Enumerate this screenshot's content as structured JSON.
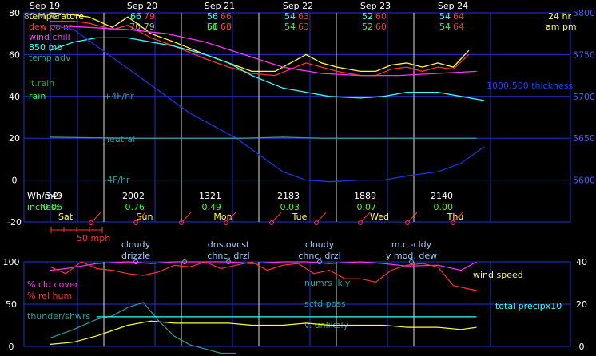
{
  "colors": {
    "temperature": "#ffff33",
    "dew_point": "#ff3333",
    "wind_chill": "#ff33ff",
    "mb850": "#33ffff",
    "temp_adv": "#339999",
    "rain": "#33ff33",
    "grid": "#2233cc",
    "thickness": "#2233dd",
    "day_line": "#ffffff",
    "white": "#ffffff"
  },
  "chart_data": [
    {
      "type": "line",
      "title": "",
      "dates": [
        "Sep 19",
        "Sep 20",
        "Sep 21",
        "Sep 22",
        "Sep 23",
        "Sep 24"
      ],
      "day_names": [
        "Sat",
        "Sun",
        "Mon",
        "Tue",
        "Wed",
        "Thu"
      ],
      "ylim": [
        -20,
        80
      ],
      "yticks": [
        "80",
        "60",
        "40",
        "20",
        "0",
        "-20"
      ],
      "y2lim": [
        5550,
        5800
      ],
      "y2ticks": [
        "5800",
        "5750",
        "5700",
        "5650",
        "5600"
      ],
      "daily_temps": [
        {
          "hi": "56",
          "lo": "66"
        },
        {
          "hi": "56",
          "lo": "66"
        },
        {
          "hi": "56",
          "lo": "66"
        },
        {
          "hi": "54",
          "lo": "63"
        },
        {
          "hi": "52",
          "lo": "60"
        },
        {
          "hi": "54",
          "lo": "64"
        }
      ],
      "daily_temps_header": [
        {
          "a": "66",
          "b": "79"
        }
      ],
      "top_text": {
        "hr": "24 hr",
        "ampm": "am pm",
        "first": "80 M 78",
        "first2": "70 79"
      },
      "labels": {
        "temperature": "temperature",
        "dew_point": "dew point",
        "wind_chill": "wind chill",
        "mb850": "850 mb",
        "temp_adv": "temp adv",
        "lt_rain": "lt.rain",
        "rain": "rain",
        "plus4": "+4F/hr",
        "neutral": "neutral",
        "minus4": "-4F/hr",
        "thickness": "1000:500 thickness",
        "wh": "Wh/m2:",
        "inches": "inches:",
        "scale": "50 mph"
      },
      "wh_values": [
        "349",
        "2002",
        "1321",
        "2183",
        "1889",
        "2140"
      ],
      "inch_values": [
        "0.06",
        "0.76",
        "0.49",
        "0.03",
        "0.07",
        "0.00"
      ],
      "series": [
        {
          "name": "temperature",
          "x": [
            0,
            0.3,
            0.5,
            0.8,
            1,
            1.3,
            1.6,
            2,
            2.3,
            2.6,
            2.9,
            3.1,
            3.3,
            3.5,
            3.7,
            4,
            4.2,
            4.4,
            4.6,
            4.8,
            5,
            5.2,
            5.4
          ],
          "values": [
            80,
            79,
            78,
            73,
            78,
            70,
            66,
            60,
            56,
            52,
            52,
            56,
            60,
            56,
            54,
            52,
            52,
            55,
            56,
            54,
            56,
            54,
            62
          ]
        },
        {
          "name": "dew point",
          "x": [
            0,
            0.3,
            0.5,
            0.8,
            1,
            1.3,
            1.6,
            2,
            2.3,
            2.6,
            2.9,
            3.1,
            3.3,
            3.5,
            3.7,
            4,
            4.2,
            4.4,
            4.6,
            4.8,
            5,
            5.2,
            5.4
          ],
          "values": [
            76,
            76,
            75,
            72,
            74,
            68,
            64,
            58,
            54,
            51,
            50,
            53,
            56,
            54,
            52,
            50,
            50,
            53,
            54,
            52,
            54,
            53,
            60
          ]
        },
        {
          "name": "wind chill",
          "x": [
            0,
            0.5,
            1,
            1.5,
            2,
            2.5,
            3,
            3.5,
            4,
            4.5,
            5,
            5.5
          ],
          "values": [
            74,
            73,
            72,
            70,
            66,
            60,
            54,
            51,
            50,
            50,
            51,
            52
          ]
        },
        {
          "name": "850 mb",
          "x": [
            0,
            0.3,
            0.6,
            1,
            1.3,
            1.6,
            2,
            2.3,
            2.6,
            3,
            3.3,
            3.6,
            4,
            4.3,
            4.6,
            5,
            5.3,
            5.6
          ],
          "values": [
            5755,
            5765,
            5770,
            5770,
            5765,
            5760,
            5750,
            5740,
            5725,
            5710,
            5705,
            5700,
            5698,
            5700,
            5705,
            5705,
            5700,
            5695
          ]
        },
        {
          "name": "1000:500 thickness",
          "x": [
            0,
            0.3,
            0.6,
            0.9,
            1.2,
            1.5,
            1.8,
            2.1,
            2.4,
            2.7,
            3,
            3.3,
            3.6,
            4,
            4.3,
            4.6,
            5,
            5.3,
            5.6
          ],
          "values": [
            5785,
            5780,
            5760,
            5740,
            5720,
            5700,
            5680,
            5665,
            5650,
            5630,
            5610,
            5600,
            5598,
            5600,
            5600,
            5605,
            5610,
            5620,
            5640
          ]
        },
        {
          "name": "temp adv",
          "x": [
            0,
            1,
            1.5,
            2,
            2.5,
            3,
            3.5,
            4,
            4.5,
            5,
            5.5
          ],
          "values": [
            20.5,
            20,
            20,
            20,
            20,
            20.5,
            20,
            20,
            20,
            20,
            20
          ]
        }
      ]
    },
    {
      "type": "line",
      "title": "",
      "ylim": [
        0,
        100
      ],
      "yticks": [
        "100",
        "50",
        "0"
      ],
      "y2lim": [
        0,
        40
      ],
      "y2ticks": [
        "40",
        "20",
        "0"
      ],
      "sky_labels": [
        {
          "l1": "cloudy",
          "l2": "drizzle"
        },
        {
          "l1": "dns.ovcst",
          "l2": "chnc. drzl"
        },
        {
          "l1": "cloudy",
          "l2": "chnc. drzl"
        },
        {
          "l1": "m.c.-cldy",
          "l2": "y mod. dew"
        }
      ],
      "labels": {
        "cld_cover": "% cld cover",
        "rel_hum": "% rel hum",
        "thunder": "thunder/shwrs",
        "wind_speed": "wind speed",
        "total_precip": "total precipx10",
        "numrs_lkly": "numrs lkly",
        "sctd_poss": "sctd poss",
        "v_unlikely": "v. unlikely"
      },
      "series": [
        {
          "name": "% cld cover",
          "x": [
            0,
            0.2,
            0.4,
            0.6,
            0.8,
            1,
            1.3,
            1.6,
            2,
            2.3,
            2.6,
            3,
            3.3,
            3.6,
            4,
            4.3,
            4.6,
            5,
            5.3,
            5.5
          ],
          "values": [
            90,
            92,
            95,
            98,
            99,
            100,
            98,
            100,
            100,
            100,
            98,
            100,
            100,
            98,
            100,
            98,
            95,
            96,
            90,
            100
          ]
        },
        {
          "name": "% rel hum",
          "x": [
            0,
            0.2,
            0.4,
            0.6,
            0.8,
            1,
            1.2,
            1.4,
            1.6,
            1.8,
            2,
            2.2,
            2.4,
            2.6,
            2.8,
            3,
            3.2,
            3.4,
            3.6,
            3.8,
            4,
            4.2,
            4.4,
            4.6,
            4.8,
            5,
            5.2,
            5.5
          ],
          "values": [
            94,
            86,
            100,
            92,
            90,
            86,
            84,
            88,
            96,
            94,
            100,
            92,
            96,
            100,
            90,
            96,
            98,
            86,
            90,
            80,
            80,
            76,
            90,
            96,
            98,
            94,
            72,
            66
          ]
        },
        {
          "name": "wind speed",
          "x": [
            0,
            0.3,
            0.6,
            1,
            1.3,
            1.6,
            2,
            2.3,
            2.6,
            3,
            3.3,
            3.6,
            4,
            4.3,
            4.6,
            5,
            5.3,
            5.5
          ],
          "values": [
            1,
            2,
            5,
            10,
            12,
            11,
            11,
            11,
            10,
            10,
            11,
            10,
            10,
            10,
            9,
            9,
            8,
            9
          ]
        },
        {
          "name": "thunder/shwrs",
          "x": [
            0,
            0.3,
            0.6,
            0.8,
            1,
            1.2,
            1.4,
            1.6,
            1.8,
            2,
            2.2,
            2.4
          ],
          "values": [
            10,
            20,
            32,
            36,
            46,
            52,
            30,
            12,
            2,
            -3,
            -8,
            -8
          ]
        }
      ]
    }
  ]
}
